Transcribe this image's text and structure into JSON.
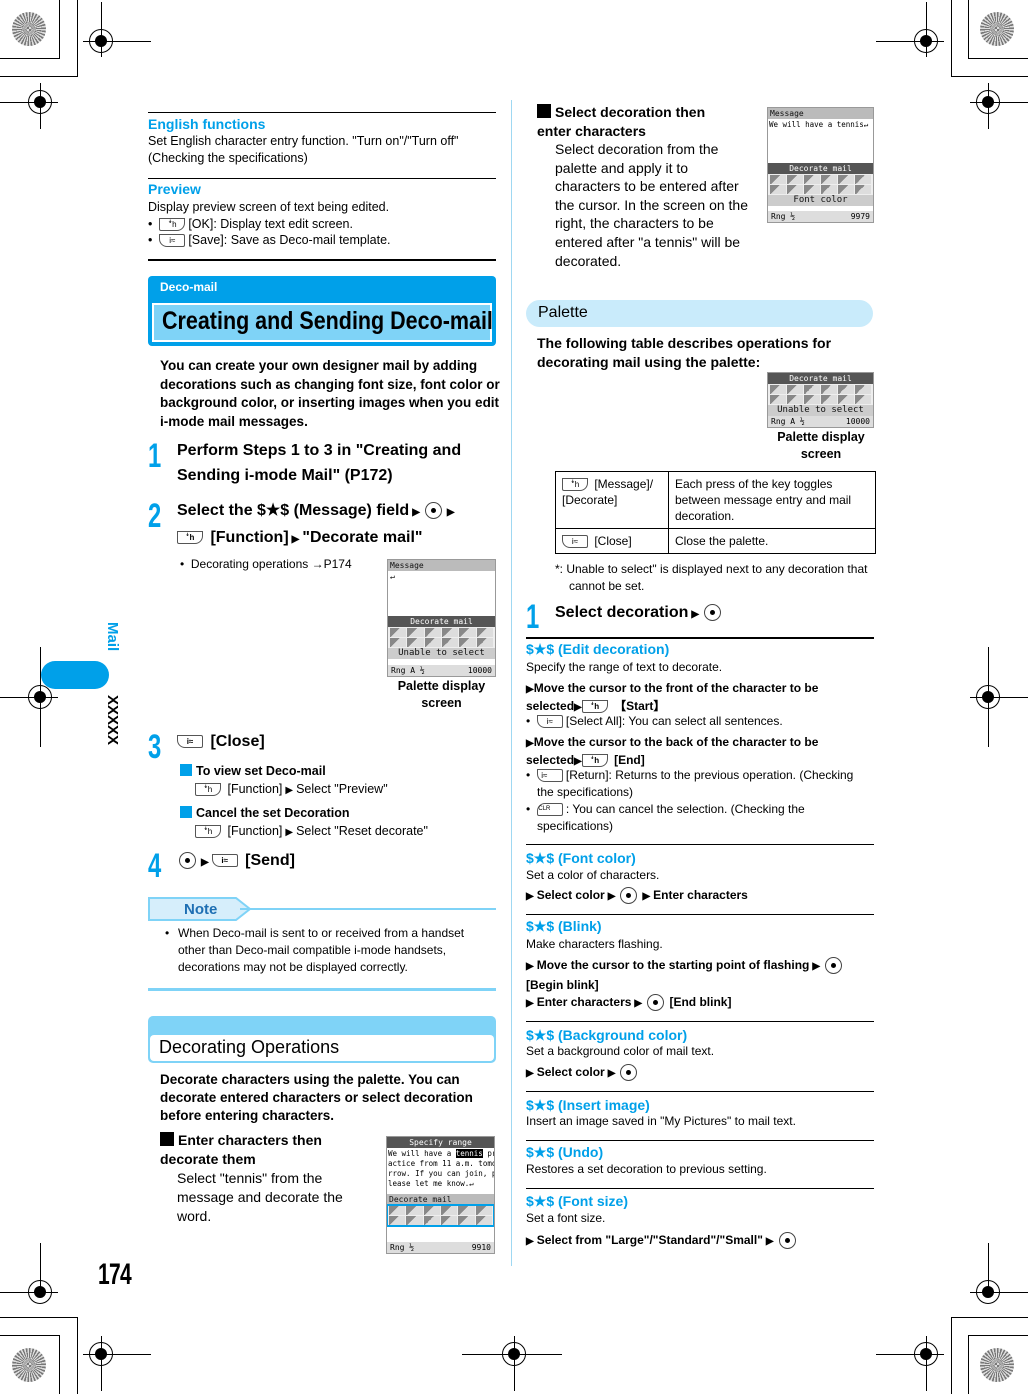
{
  "side_tab": {
    "section": "Mail",
    "code": "XXXXX"
  },
  "page_number": "174",
  "left_column": {
    "english_functions": {
      "title": "English functions",
      "body": "Set English character entry function. \"Turn on\"/\"Turn off\" (Checking the specifications)"
    },
    "preview": {
      "title": "Preview",
      "body": "Display preview screen of text being edited.",
      "bullets": [
        {
          "key": "left-soft-key",
          "text": "[OK]: Display text edit screen."
        },
        {
          "key": "right-soft-key",
          "text": "[Save]: Save as Deco-mail template."
        }
      ]
    },
    "deco_header": {
      "category": "Deco-mail",
      "title": "Creating and Sending Deco-mail"
    },
    "intro": "You can create your own designer mail by adding decorations such as changing font size, font color or background color, or inserting images when you edit i-mode mail messages.",
    "steps": [
      {
        "num": "1",
        "text": "Perform Steps 1 to 3 in \"Creating and Sending i-mode Mail\" (P172)"
      },
      {
        "num": "2",
        "text_a": "Select the $★$ (Message) field",
        "text_b": "[Function]",
        "text_c": "\"Decorate mail\"",
        "bullet": "Decorating operations →P174"
      },
      {
        "num": "3",
        "text": "[Close]",
        "subs": [
          {
            "title": "To view set Deco-mail",
            "body_a": "[Function]",
            "body_b": "Select \"Preview\""
          },
          {
            "title": "Cancel the set Decoration",
            "body_a": "[Function]",
            "body_b": "Select \"Reset decorate\""
          }
        ]
      },
      {
        "num": "4",
        "text": "[Send]"
      }
    ],
    "screenshot1": {
      "header": "Message",
      "palette_bar": "Decorate mail",
      "status_bar": "Unable to select",
      "counter": "10000",
      "caption": "Palette display screen"
    },
    "note": {
      "label": "Note",
      "text": "When Deco-mail is sent to or received from a handset other than Deco-mail compatible i-mode handsets, decorations may not be displayed correctly."
    },
    "decorating_ops": {
      "title": "Decorating Operations",
      "intro": "Decorate characters using the palette. You can decorate entered characters or select decoration before entering characters.",
      "enter_then_decorate": {
        "title": "Enter characters then decorate them",
        "body": "Select \"tennis\" from the message and decorate the word."
      },
      "screenshot2": {
        "header": "Specify range",
        "lines": [
          "We will have a tennis pr",
          "actice from 11 a.m. tomo",
          "rrow. If you can join, p",
          "lease let me know.↵"
        ],
        "highlight": "tennis",
        "palette_bar": "Decorate mail",
        "counter": "9910"
      }
    }
  },
  "right_column": {
    "select_then_enter": {
      "title": "Select decoration then enter characters",
      "body": "Select decoration from the palette and apply it to characters to be entered after the cursor. In the screen on the right, the characters to be entered after \"a tennis\" will be decorated."
    },
    "screenshot3": {
      "header": "Message",
      "line": "We will have a tennis↵",
      "palette_bar": "Decorate mail",
      "status_bar": "Font color",
      "counter": "9979"
    },
    "palette": {
      "title": "Palette",
      "intro": "The following table describes operations for decorating mail using the palette:",
      "screenshot4": {
        "palette_bar": "Decorate mail",
        "status_bar": "Unable to select",
        "counter": "10000",
        "caption": "Palette display screen"
      },
      "table": [
        {
          "key": "[Message]/ [Decorate]",
          "desc": "Each press of the key toggles between message entry and mail decoration."
        },
        {
          "key": "[Close]",
          "desc": "Close the palette."
        }
      ],
      "footnote": "*:  Unable to select\" is displayed next to any decoration that cannot be set.",
      "step1": "Select decoration"
    },
    "functions": [
      {
        "title": "$★$ (Edit decoration)",
        "body": "Specify the range of text to decorate.",
        "op1": "Move the cursor to the front of the character to be selected",
        "op1_end": "【Start】",
        "bullet1": "[Select All]: You can select all sentences.",
        "op2": "Move the cursor to the back of the character to be selected",
        "op2_end": "[End]",
        "bullet2": "[Return]: Returns to the previous operation. (Checking the specifications)",
        "bullet3": ": You can cancel the selection. (Checking the specifications)"
      },
      {
        "title": "$★$ (Font color)",
        "body": "Set a color of characters.",
        "op_a": "Select color",
        "op_b": "Enter characters"
      },
      {
        "title": "$★$ (Blink)",
        "body": "Make characters flashing.",
        "op_a": "Move the cursor to the starting point of flashing",
        "op_b": "[Begin blink]",
        "op_c": "Enter characters",
        "op_d": "[End blink]"
      },
      {
        "title": "$★$ (Background color)",
        "body": "Set a background color of mail text.",
        "op_a": "Select color"
      },
      {
        "title": "$★$ (Insert image)",
        "body": "Insert an image saved in \"My Pictures\" to mail text."
      },
      {
        "title": "$★$ (Undo)",
        "body": "Restores a set decoration to previous setting."
      },
      {
        "title": "$★$ (Font size)",
        "body": "Set a font size.",
        "op_a": "Select from \"Large\"/\"Standard\"/\"Small\""
      }
    ]
  },
  "keys": {
    "left_soft": "ꜜh",
    "right_soft": "i≈",
    "clr": "CLR"
  },
  "colors": {
    "accent": "#00a0e9",
    "accent_light": "#7fd3f7",
    "section_pale": "#c9ebfb"
  }
}
